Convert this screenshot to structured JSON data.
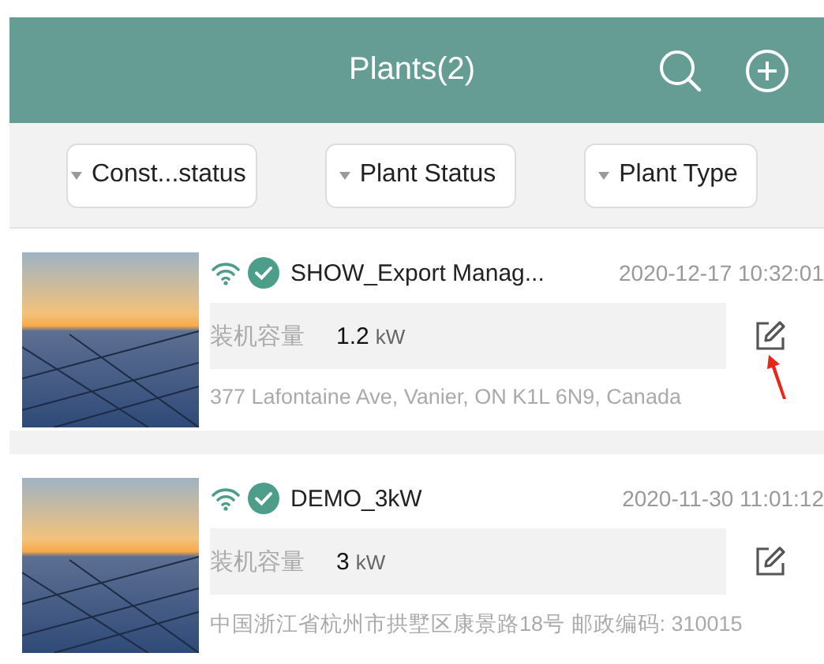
{
  "header": {
    "title": "Plants(2)"
  },
  "filters": [
    {
      "label": "Const...status"
    },
    {
      "label": "Plant Status"
    },
    {
      "label": "Plant Type"
    }
  ],
  "plants": [
    {
      "name": "SHOW_Export Manag...",
      "time": "2020-12-17 10:32:01",
      "capacity_label": "装机容量",
      "capacity_value": "1.2",
      "capacity_unit": "kW",
      "address": "377 Lafontaine Ave, Vanier, ON K1L 6N9, Canada",
      "annotated": true
    },
    {
      "name": "DEMO_3kW",
      "time": "2020-11-30 11:01:12",
      "capacity_label": "装机容量",
      "capacity_value": "3",
      "capacity_unit": "kW",
      "address": "中国浙江省杭州市拱墅区康景路18号 邮政编码: 310015",
      "annotated": false
    }
  ]
}
